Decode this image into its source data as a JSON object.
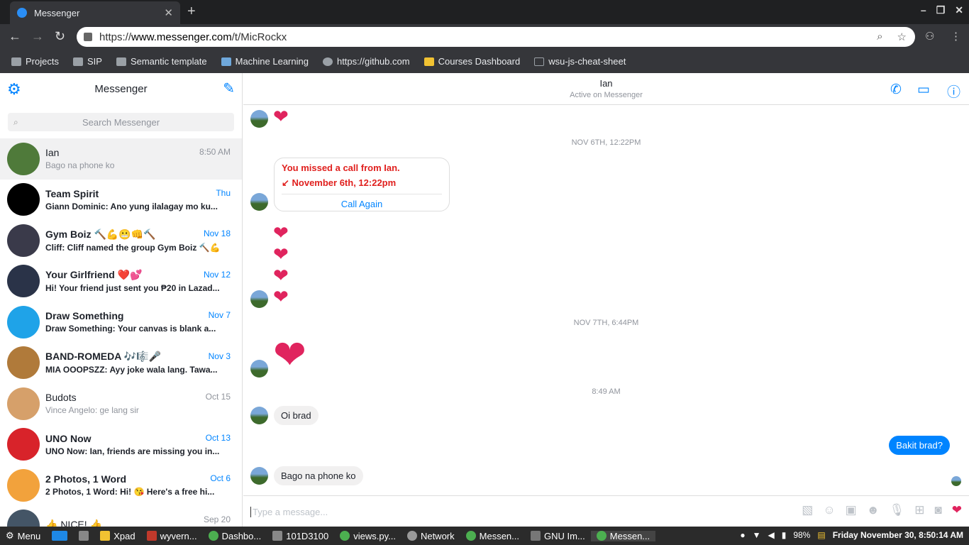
{
  "browser": {
    "tab_title": "Messenger",
    "url_prefix": "https://",
    "url_host": "www.messenger.com",
    "url_path": "/t/MicRockx",
    "bookmarks": [
      "Projects",
      "SIP",
      "Semantic template",
      "Machine Learning",
      "https://github.com",
      "Courses Dashboard",
      "wsu-js-cheat-sheet"
    ]
  },
  "sidebar": {
    "title": "Messenger",
    "search_placeholder": "Search Messenger",
    "conversations": [
      {
        "name": "Ian",
        "snippet": "Bago na phone ko",
        "time": "8:50 AM",
        "unread": false,
        "active": true,
        "avatar_color": "#4f7a3a"
      },
      {
        "name": "Team Spirit",
        "snippet": "Giann Dominic: Ano yung ilalagay mo ku...",
        "time": "Thu",
        "unread": true,
        "avatar_color": "#000000"
      },
      {
        "name": "Gym Boiz 🔨💪😬👊🔨",
        "snippet": "Cliff: Cliff named the group Gym Boiz 🔨💪",
        "time": "Nov 18",
        "unread": true,
        "avatar_color": "#3a3a4a"
      },
      {
        "name": "Your Girlfriend ❤️💕",
        "snippet": "Hi! Your friend just sent you ₱20 in Lazad...",
        "time": "Nov 12",
        "unread": true,
        "avatar_color": "#2a3348"
      },
      {
        "name": "Draw Something",
        "snippet": "Draw Something: Your canvas is blank a...",
        "time": "Nov 7",
        "unread": true,
        "avatar_color": "#1fa3e8"
      },
      {
        "name": "BAND-ROMEDA 🎶🎼🎤",
        "snippet": "MIA OOOPSZZ: Ayy joke wala lang. Tawa...",
        "time": "Nov 3",
        "unread": true,
        "avatar_color": "#b07a3a"
      },
      {
        "name": "Budots",
        "snippet": "Vince Angelo: ge lang sir",
        "time": "Oct 15",
        "unread": false,
        "avatar_color": "#d6a06a"
      },
      {
        "name": "UNO Now",
        "snippet": "UNO Now: Ian, friends are missing you in...",
        "time": "Oct 13",
        "unread": true,
        "avatar_color": "#d8232a"
      },
      {
        "name": "2 Photos, 1 Word",
        "snippet": "2 Photos, 1 Word: Hi! 😘 Here's a free hi...",
        "time": "Oct 6",
        "unread": true,
        "avatar_color": "#f2a23c"
      },
      {
        "name": "👍 NICE! 👍",
        "snippet": "",
        "time": "Sep 20",
        "unread": false,
        "avatar_color": "#445566"
      }
    ]
  },
  "chat": {
    "contact_name": "Ian",
    "contact_status": "Active on Messenger",
    "stamp1": "NOV 6TH, 12:22PM",
    "missed_call": "You missed a call from Ian.",
    "missed_time": "November 6th, 12:22pm",
    "call_again": "Call Again",
    "stamp2": "NOV 7TH, 6:44PM",
    "stamp3": "8:49 AM",
    "msg1": "Oi brad",
    "msg2": "Bakit brad?",
    "msg3": "Bago na phone ko",
    "composer_placeholder": "Type a message..."
  },
  "taskbar": {
    "menu": "Menu",
    "items": [
      "Xpad",
      "wyvern...",
      "Dashbo...",
      "101D3100",
      "views.py...",
      "Network",
      "Messen...",
      "GNU Im...",
      "Messen..."
    ],
    "battery": "98%",
    "clock": "Friday November 30,  8:50:14 AM"
  }
}
